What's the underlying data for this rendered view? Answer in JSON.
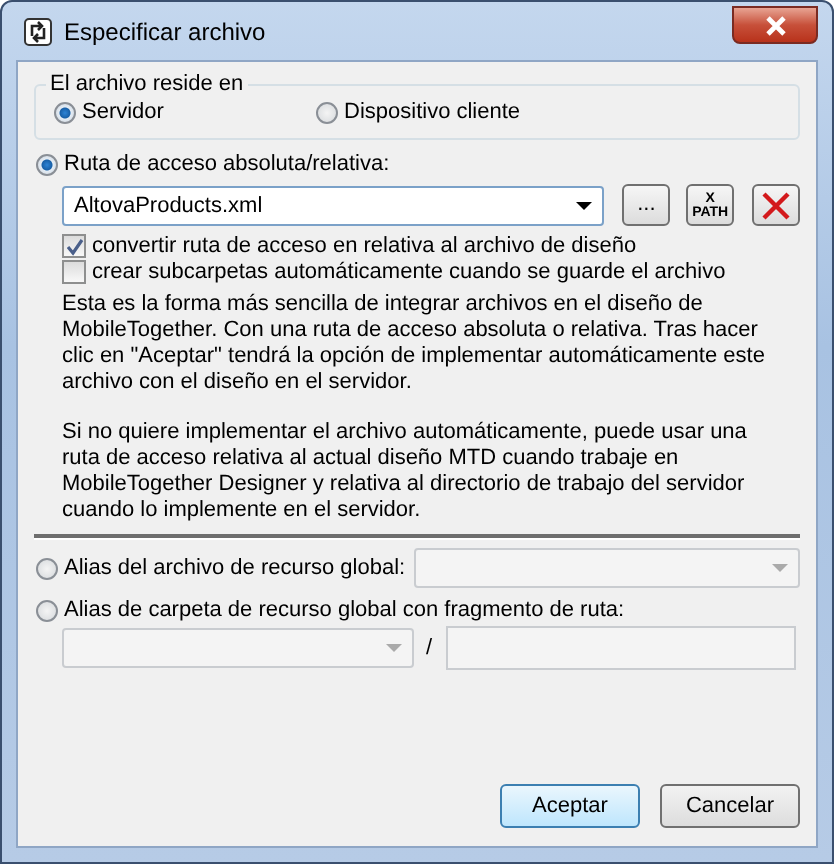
{
  "window": {
    "title": "Especificar archivo"
  },
  "location_group": {
    "legend": "El archivo reside en",
    "options": [
      {
        "label": "Servidor",
        "selected": true
      },
      {
        "label": "Dispositivo cliente",
        "selected": false
      }
    ]
  },
  "source_options": [
    {
      "kind": "path",
      "label": "Ruta de acceso absoluta/relativa:",
      "selected": true,
      "value": "AltovaProducts.xml",
      "tools": [
        {
          "kind": "browse",
          "label": "..."
        },
        {
          "kind": "xpath",
          "label": "X",
          "sublabel": "PATH"
        },
        {
          "kind": "clear"
        }
      ],
      "checkboxes": [
        {
          "label": "convertir ruta de acceso en relativa al archivo de diseño",
          "checked": true
        },
        {
          "label": "crear subcarpetas automáticamente cuando se guarde el archivo",
          "checked": false
        }
      ],
      "description": [
        "Esta es la forma más sencilla de integrar archivos en el diseño de MobileTogether. Con una ruta de acceso absoluta o relativa. Tras hacer clic en \"Aceptar\" tendrá la opción de implementar automáticamente este archivo con el diseño en el servidor.",
        "Si no quiere implementar el archivo automáticamente, puede usar una ruta de acceso relativa al actual diseño MTD cuando trabaje en MobileTogether Designer y relativa al directorio de trabajo del servidor cuando lo implemente en el servidor."
      ]
    },
    {
      "kind": "file_alias",
      "label": "Alias del archivo de recurso global:",
      "selected": false
    },
    {
      "kind": "folder_alias",
      "label": "Alias de carpeta de recurso global con fragmento de ruta:",
      "selected": false,
      "separator": "/"
    }
  ],
  "buttons": [
    {
      "label": "Aceptar",
      "default": true
    },
    {
      "label": "Cancelar",
      "default": false
    }
  ]
}
